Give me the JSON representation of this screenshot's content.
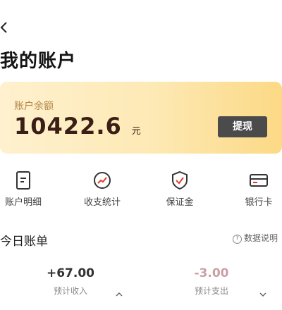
{
  "header": {
    "back_icon": "chevron-left-icon",
    "title": "我的账户"
  },
  "balance_card": {
    "label": "账户余额",
    "amount": "10422.6",
    "unit": "元",
    "withdraw_label": "提现",
    "gradient_colors": [
      "#fff1cf",
      "#fcd985"
    ]
  },
  "quick_actions": [
    {
      "label": "账户明细",
      "icon": "document-icon"
    },
    {
      "label": "收支统计",
      "icon": "stats-gauge-icon"
    },
    {
      "label": "保证金",
      "icon": "shield-check-icon"
    },
    {
      "label": "银行卡",
      "icon": "bank-card-icon"
    }
  ],
  "today_bill": {
    "title": "今日账单",
    "data_note": "数据说明",
    "income": {
      "value": "+67.00",
      "label": "预计收入",
      "color": "#333333",
      "chevron": "chevron-up-icon"
    },
    "expense": {
      "value": "-3.00",
      "label": "预计支出",
      "color": "#c9a0a4",
      "chevron": "chevron-down-icon"
    }
  }
}
